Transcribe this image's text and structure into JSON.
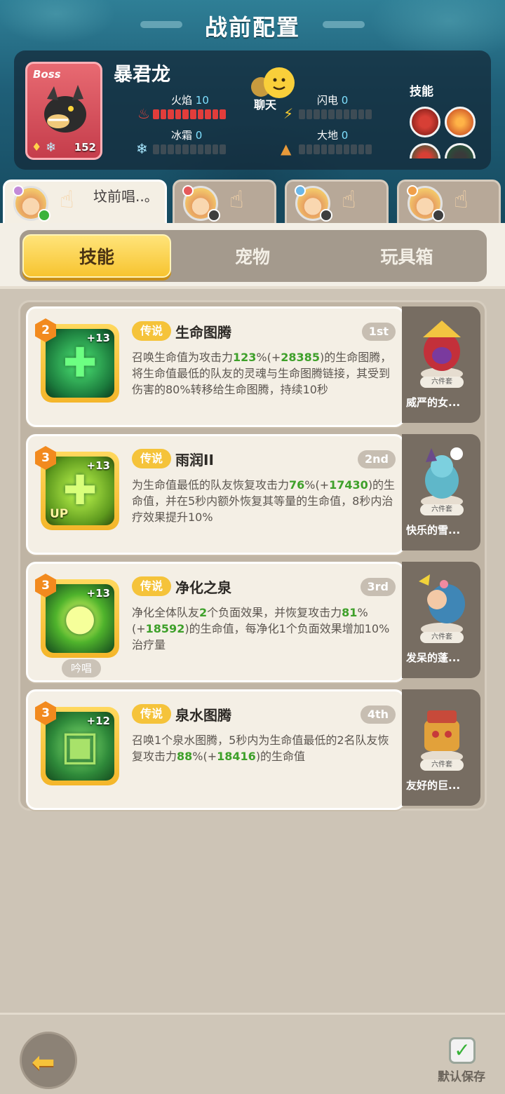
{
  "header": {
    "title": "战前配置"
  },
  "boss": {
    "tag": "Boss",
    "name": "暴君龙",
    "level": "152",
    "elements": {
      "fire": {
        "label": "火焰",
        "value": "10"
      },
      "lightning": {
        "label": "闪电",
        "value": "0"
      },
      "ice": {
        "label": "冰霜",
        "value": "0"
      },
      "earth": {
        "label": "大地",
        "value": "0"
      }
    },
    "chat_label": "聊天",
    "skills_label": "技能"
  },
  "hero_tabs": [
    {
      "label": "坟前唱..。",
      "dot_color": "#c38ad8",
      "active": true
    },
    {
      "label": "",
      "dot_color": "#e55a5a",
      "active": false
    },
    {
      "label": "",
      "dot_color": "#6bb7e8",
      "active": false
    },
    {
      "label": "",
      "dot_color": "#f0a04a",
      "active": false
    }
  ],
  "category_tabs": [
    {
      "label": "技能",
      "active": true
    },
    {
      "label": "宠物",
      "active": false
    },
    {
      "label": "玩具箱",
      "active": false
    }
  ],
  "skills": [
    {
      "level": "2",
      "plus": "+13",
      "rarity": "传说",
      "name": "生命图腾",
      "rank": "1st",
      "desc": [
        {
          "t": "召唤生命值为攻击力"
        },
        {
          "t": "123",
          "g": true
        },
        {
          "t": "%(+"
        },
        {
          "t": "28385",
          "g": true
        },
        {
          "t": ")的生命图腾，将生命值最低的队友的灵魂与生命图腾链接，其受到伤害的80%转移给生命图腾，持续10秒"
        }
      ],
      "pet": {
        "set": "六件套",
        "name": "威严的女..."
      }
    },
    {
      "level": "3",
      "plus": "+13",
      "up": "UP",
      "rarity": "传说",
      "name": "雨润II",
      "rank": "2nd",
      "desc": [
        {
          "t": "为生命值最低的队友恢复攻击力"
        },
        {
          "t": "76",
          "g": true
        },
        {
          "t": "%(+"
        },
        {
          "t": "17430",
          "g": true
        },
        {
          "t": ")的生命值，并在5秒内额外恢复其等量的生命值，8秒内治疗效果提升10%"
        }
      ],
      "pet": {
        "set": "六件套",
        "name": "快乐的雪..."
      }
    },
    {
      "level": "3",
      "plus": "+13",
      "chant": "吟唱",
      "rarity": "传说",
      "name": "净化之泉",
      "rank": "3rd",
      "desc": [
        {
          "t": "净化全体队友"
        },
        {
          "t": "2",
          "g": true
        },
        {
          "t": "个负面效果，并恢复攻击力"
        },
        {
          "t": "81",
          "g": true
        },
        {
          "t": "%(+"
        },
        {
          "t": "18592",
          "g": true
        },
        {
          "t": ")的生命值，每净化1个负面效果增加10%治疗量"
        }
      ],
      "pet": {
        "set": "六件套",
        "name": "发呆的蓬..."
      }
    },
    {
      "level": "3",
      "plus": "+12",
      "rarity": "传说",
      "name": "泉水图腾",
      "rank": "4th",
      "desc": [
        {
          "t": "召唤1个泉水图腾，5秒内为生命值最低的2名队友恢复攻击力"
        },
        {
          "t": "88",
          "g": true
        },
        {
          "t": "%(+"
        },
        {
          "t": "18416",
          "g": true
        },
        {
          "t": ")的生命值"
        }
      ],
      "pet": {
        "set": "六件套",
        "name": "友好的巨..."
      }
    }
  ],
  "footer": {
    "save_label": "默认保存"
  }
}
